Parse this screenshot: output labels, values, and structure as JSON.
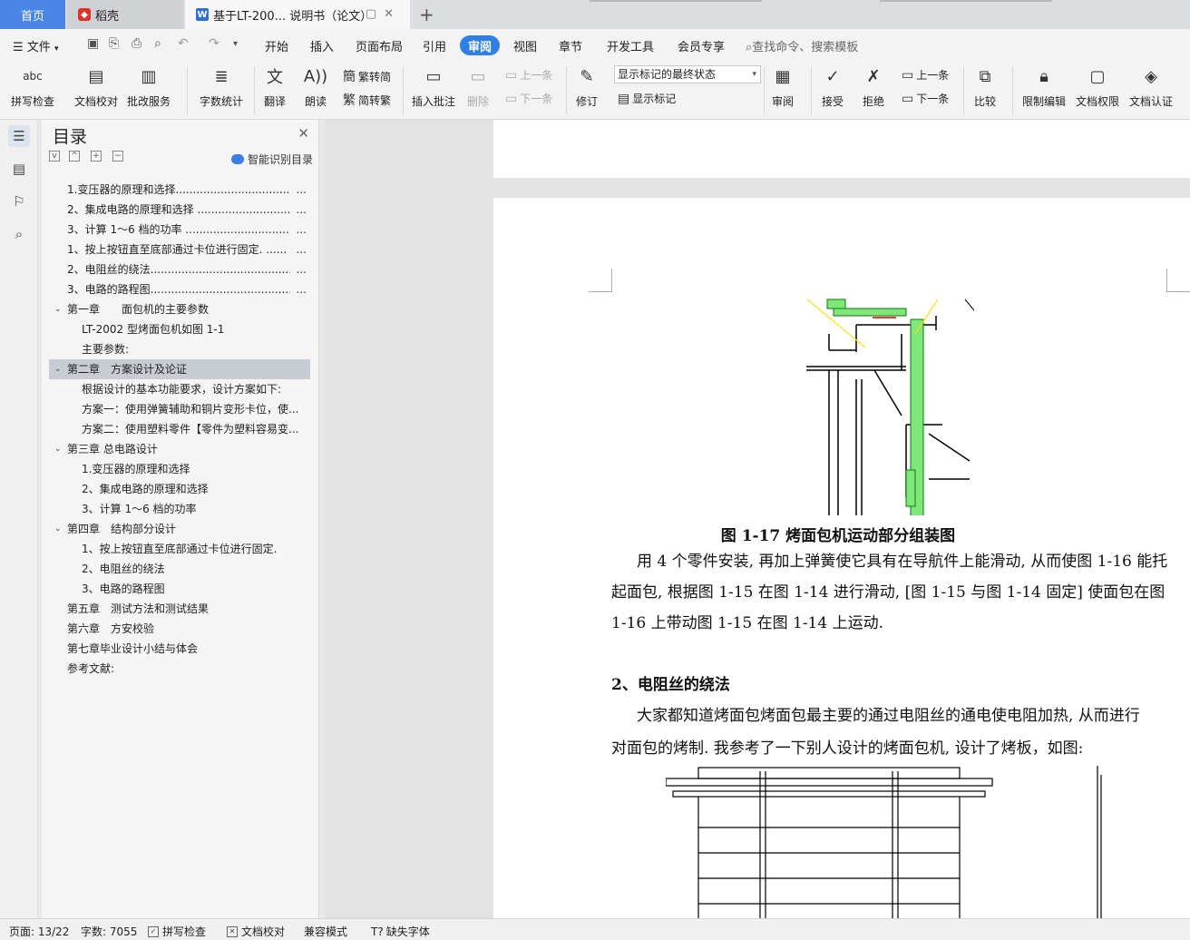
{
  "tabs": {
    "home": "首页",
    "daoke": "稻壳",
    "doc": "基于LT-200... 说明书（论文）"
  },
  "menu": {
    "file": "文件",
    "items": [
      "开始",
      "插入",
      "页面布局",
      "引用",
      "审阅",
      "视图",
      "章节",
      "开发工具",
      "会员专享"
    ],
    "active": "审阅",
    "search_placeholder": "查找命令、搜索模板"
  },
  "ribbon": {
    "spell_check": "拼写检查",
    "doc_proof": "文档校对",
    "batch_service": "批改服务",
    "word_count": "字数统计",
    "translate": "翻译",
    "read_aloud": "朗读",
    "trad_simp": "繁转简",
    "simp_trad": "简转繁",
    "insert_comment": "插入批注",
    "delete": "删除",
    "prev_comment": "上一条",
    "next_comment": "下一条",
    "track_changes": "修订",
    "markup_state": "显示标记的最终状态",
    "show_markup": "显示标记",
    "review": "审阅",
    "accept": "接受",
    "reject": "拒绝",
    "prev_change": "上一条",
    "next_change": "下一条",
    "compare": "比较",
    "restrict_edit": "限制编辑",
    "doc_rights": "文档权限",
    "doc_auth": "文档认证"
  },
  "toc": {
    "title": "目录",
    "smart_toc": "智能识别目录",
    "items": [
      {
        "text": "1.变压器的原理和选择.......................................",
        "dots": "...",
        "level": 1,
        "caret": false,
        "selected": false
      },
      {
        "text": "2、集成电路的原理和选择 .................................",
        "dots": "...",
        "level": 1,
        "caret": false,
        "selected": false
      },
      {
        "text": "3、计算 1～6 档的功率 ......................................",
        "dots": "...",
        "level": 1,
        "caret": false,
        "selected": false
      },
      {
        "text": "1、按上按钮直至底部通过卡位进行固定. ......",
        "dots": "...",
        "level": 1,
        "caret": false,
        "selected": false
      },
      {
        "text": "2、电阻丝的绕法...............................................",
        "dots": "...",
        "level": 1,
        "caret": false,
        "selected": false
      },
      {
        "text": "3、电路的路程图...............................................",
        "dots": "...",
        "level": 1,
        "caret": false,
        "selected": false
      },
      {
        "text": "第一章　　面包机的主要参数",
        "dots": "",
        "level": 1,
        "caret": true,
        "selected": false
      },
      {
        "text": "LT-2002 型烤面包机如图 1-1",
        "dots": "",
        "level": 2,
        "caret": false,
        "selected": false
      },
      {
        "text": "主要参数:",
        "dots": "",
        "level": 2,
        "caret": false,
        "selected": false
      },
      {
        "text": "第二章　方案设计及论证",
        "dots": "",
        "level": 1,
        "caret": true,
        "selected": true
      },
      {
        "text": "根据设计的基本功能要求，设计方案如下:",
        "dots": "",
        "level": 2,
        "caret": false,
        "selected": false
      },
      {
        "text": "方案一：使用弹簧辅助和铜片变形卡位，使...",
        "dots": "",
        "level": 2,
        "caret": false,
        "selected": false
      },
      {
        "text": "方案二：使用塑料零件【零件为塑料容易变...",
        "dots": "",
        "level": 2,
        "caret": false,
        "selected": false
      },
      {
        "text": "第三章 总电路设计",
        "dots": "",
        "level": 1,
        "caret": true,
        "selected": false
      },
      {
        "text": "1.变压器的原理和选择",
        "dots": "",
        "level": 2,
        "caret": false,
        "selected": false
      },
      {
        "text": "2、集成电路的原理和选择",
        "dots": "",
        "level": 2,
        "caret": false,
        "selected": false
      },
      {
        "text": "3、计算 1～6 档的功率",
        "dots": "",
        "level": 2,
        "caret": false,
        "selected": false
      },
      {
        "text": "第四章　结构部分设计",
        "dots": "",
        "level": 1,
        "caret": true,
        "selected": false
      },
      {
        "text": "1、按上按钮直至底部通过卡位进行固定.",
        "dots": "",
        "level": 2,
        "caret": false,
        "selected": false
      },
      {
        "text": "2、电阻丝的绕法",
        "dots": "",
        "level": 2,
        "caret": false,
        "selected": false
      },
      {
        "text": "3、电路的路程图",
        "dots": "",
        "level": 2,
        "caret": false,
        "selected": false
      },
      {
        "text": "第五章　测试方法和测试结果",
        "dots": "",
        "level": 1,
        "caret": false,
        "selected": false
      },
      {
        "text": "第六章　方安校验",
        "dots": "",
        "level": 1,
        "caret": false,
        "selected": false
      },
      {
        "text": "第七章毕业设计小结与体会",
        "dots": "",
        "level": 1,
        "caret": false,
        "selected": false
      },
      {
        "text": "参考文献:",
        "dots": "",
        "level": 1,
        "caret": false,
        "selected": false
      }
    ]
  },
  "document": {
    "caption": "图 1-17 烤面包机运动部分组装图",
    "para1_lines": [
      "用 4 个零件安装, 再加上弹簧使它具有在导航件上能滑动, 从而使图 1-16 能托",
      "起面包, 根据图 1-15 在图 1-14 进行滑动, [图 1-15 与图 1-14 固定] 使面包在图",
      "1-16 上带动图 1-15 在图 1-14 上运动."
    ],
    "heading": "2、电阻丝的绕法",
    "para2_lines": [
      "大家都知道烤面包烤面包最主要的通过电阻丝的通电使电阻加热, 从而进行",
      "对面包的烤制. 我参考了一下别人设计的烤面包机, 设计了烤板，如图:"
    ]
  },
  "status": {
    "page": "页面: 13/22",
    "words": "字数: 7055",
    "spell": "拼写检查",
    "proof": "文档校对",
    "compat": "兼容模式",
    "missing_font": "缺失字体"
  },
  "colors": {
    "accent": "#2f7fe6",
    "home_tab": "#4a86e8",
    "toc_selected": "#c8ccd3"
  }
}
